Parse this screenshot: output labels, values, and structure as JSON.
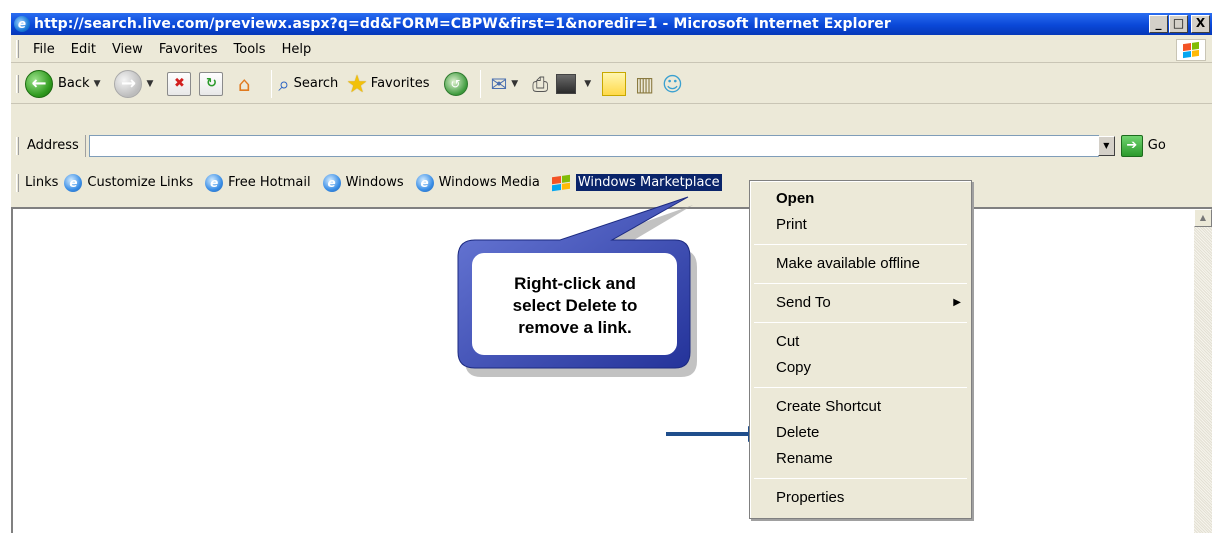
{
  "window": {
    "title": "http://search.live.com/previewx.aspx?q=dd&FORM=CBPW&first=1&noredir=1 - Microsoft Internet Explorer",
    "minimize": "_",
    "maximize": "□",
    "close": "X"
  },
  "menubar": {
    "items": [
      "File",
      "Edit",
      "View",
      "Favorites",
      "Tools",
      "Help"
    ]
  },
  "toolbar": {
    "back": "Back",
    "search": "Search",
    "favorites": "Favorites"
  },
  "address": {
    "label": "Address",
    "value": "",
    "go": "Go"
  },
  "links": {
    "label": "Links",
    "items": [
      "Customize Links",
      "Free Hotmail",
      "Windows",
      "Windows Media",
      "Windows Marketplace"
    ]
  },
  "callout": {
    "line1": "Right-click and",
    "line2": "select Delete to",
    "line3": "remove a link."
  },
  "context_menu": {
    "items": [
      "Open",
      "Print",
      "Make available offline",
      "Send To",
      "Cut",
      "Copy",
      "Create Shortcut",
      "Delete",
      "Rename",
      "Properties"
    ]
  },
  "colors": {
    "titlebar": "#0a48d8",
    "callout_fill": "#3d4fb8",
    "arrow": "#1f4e8c",
    "selection": "#0a246a"
  },
  "icons": [
    "ie-icon",
    "windows-flag-icon",
    "back-icon",
    "forward-icon",
    "stop-icon",
    "refresh-icon",
    "home-icon",
    "search-icon",
    "favorites-star-icon",
    "media-icon",
    "mail-icon",
    "print-icon",
    "go-arrow-icon",
    "marketplace-icon"
  ]
}
